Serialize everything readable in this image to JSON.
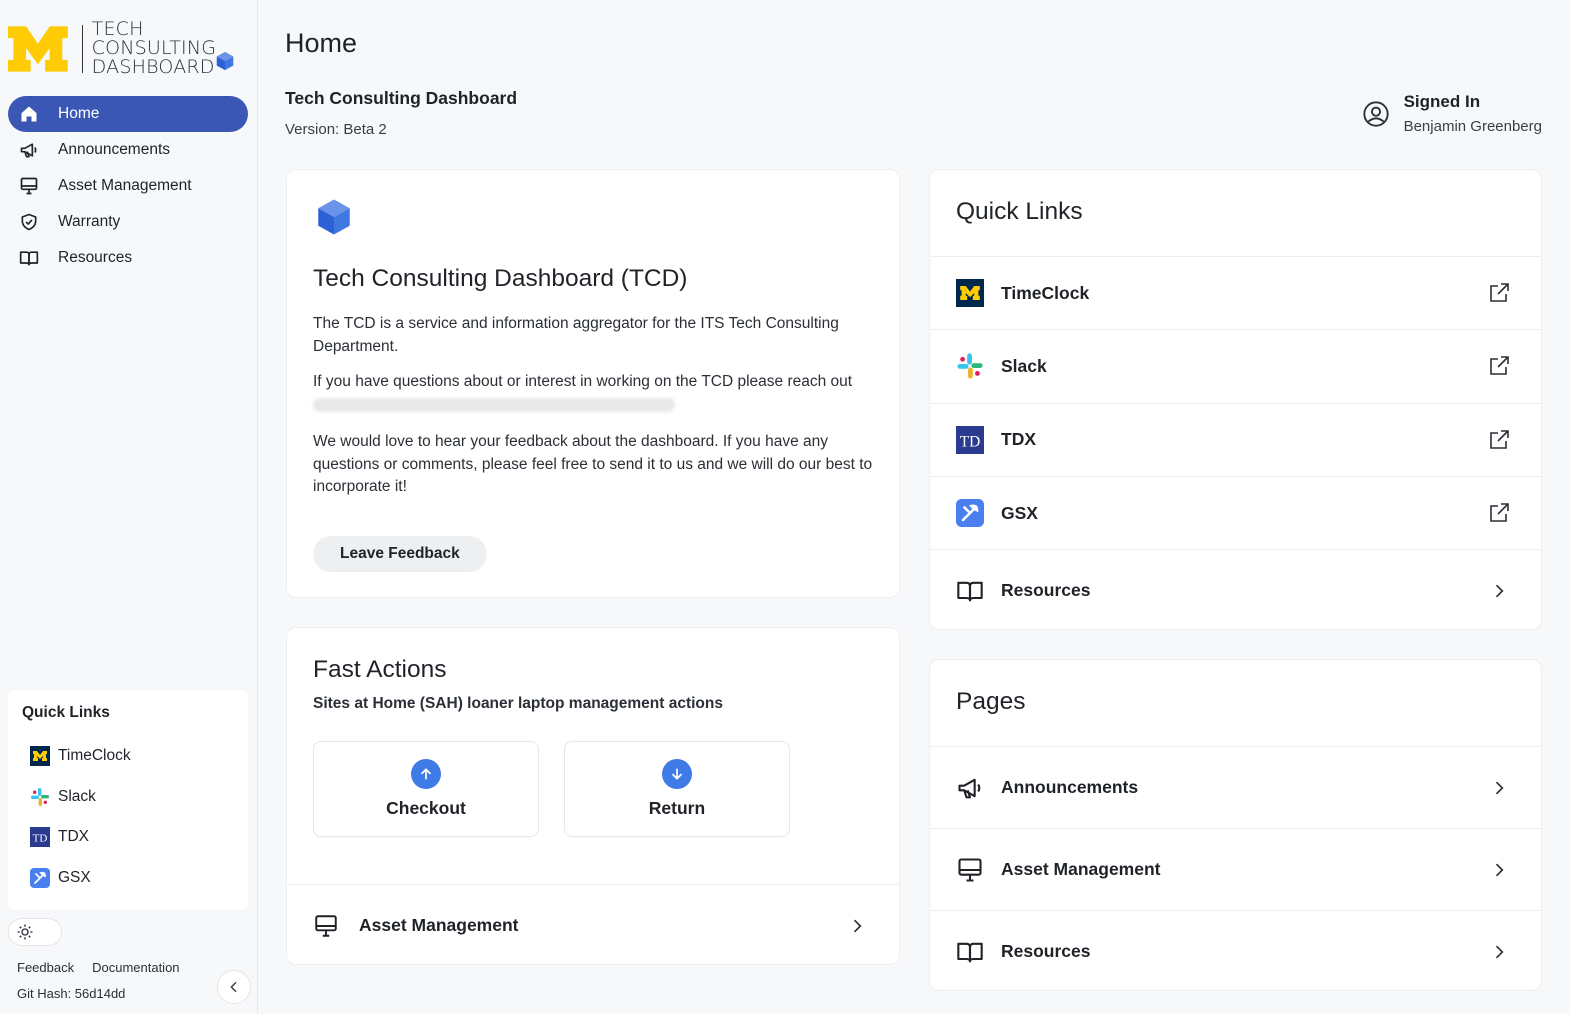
{
  "logo": {
    "line1": "TECH CONSULTING",
    "line2": "DASHBOARD",
    "maize": "#FFCB05",
    "blue": "#3a57b5"
  },
  "nav": {
    "items": [
      {
        "label": "Home",
        "icon": "home-icon",
        "active": true
      },
      {
        "label": "Announcements",
        "icon": "megaphone-icon",
        "active": false
      },
      {
        "label": "Asset Management",
        "icon": "monitor-icon",
        "active": false
      },
      {
        "label": "Warranty",
        "icon": "shield-check-icon",
        "active": false
      },
      {
        "label": "Resources",
        "icon": "book-open-icon",
        "active": false
      }
    ]
  },
  "sidebar_quick_links": {
    "title": "Quick Links",
    "items": [
      {
        "label": "TimeClock",
        "icon": "umich-m-icon"
      },
      {
        "label": "Slack",
        "icon": "slack-icon"
      },
      {
        "label": "TDX",
        "icon": "tdx-icon"
      },
      {
        "label": "GSX",
        "icon": "gsx-icon"
      }
    ]
  },
  "footer": {
    "feedback": "Feedback",
    "documentation": "Documentation",
    "git_hash": "Git Hash: 56d14dd"
  },
  "header": {
    "page_title": "Home",
    "app_title": "Tech Consulting Dashboard",
    "version": "Version: Beta 2",
    "signed_in_label": "Signed In",
    "user_name": "Benjamin Greenberg"
  },
  "tcd_card": {
    "heading": "Tech Consulting Dashboard (TCD)",
    "p1": "The TCD is a service and information aggregator for the ITS Tech Consulting Department.",
    "p2": "If you have questions about or interest in working on the TCD please reach out",
    "p3": "We would love to hear your feedback about the dashboard. If you have any questions or comments, please feel free to send it to us and we will do our best to incorporate it!",
    "button": "Leave Feedback"
  },
  "fast_actions": {
    "title": "Fast Actions",
    "subtitle": "Sites at Home (SAH) loaner laptop management actions",
    "checkout": "Checkout",
    "return": "Return",
    "row_label": "Asset Management"
  },
  "quick_links": {
    "title": "Quick Links",
    "items": [
      {
        "label": "TimeClock",
        "icon": "umich-m-icon",
        "trail": "external-link-icon"
      },
      {
        "label": "Slack",
        "icon": "slack-icon",
        "trail": "external-link-icon"
      },
      {
        "label": "TDX",
        "icon": "tdx-icon",
        "trail": "external-link-icon"
      },
      {
        "label": "GSX",
        "icon": "gsx-icon",
        "trail": "external-link-icon"
      },
      {
        "label": "Resources",
        "icon": "book-open-icon",
        "trail": "chevron-right-icon"
      }
    ]
  },
  "pages": {
    "title": "Pages",
    "items": [
      {
        "label": "Announcements",
        "icon": "megaphone-icon"
      },
      {
        "label": "Asset Management",
        "icon": "monitor-icon"
      },
      {
        "label": "Resources",
        "icon": "book-open-icon"
      }
    ]
  }
}
